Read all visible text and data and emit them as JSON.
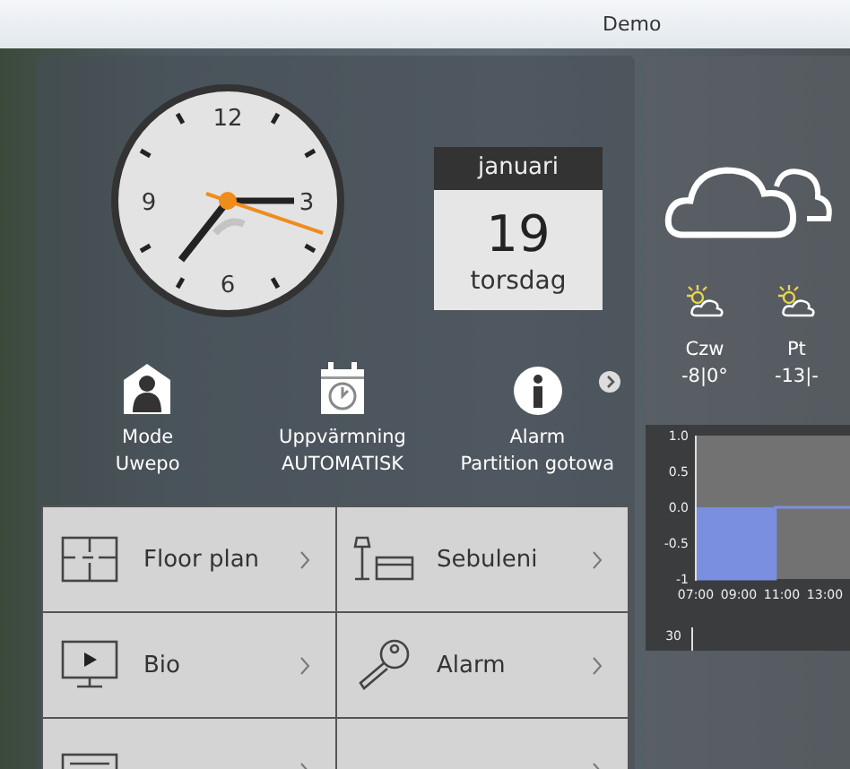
{
  "window": {
    "title": "Demo"
  },
  "clock": {
    "numerals": [
      "12",
      "3",
      "6",
      "9"
    ]
  },
  "calendar": {
    "month": "januari",
    "day": "19",
    "weekday": "torsdag"
  },
  "status_items": [
    {
      "kind": "mode",
      "label": "Mode",
      "value": "Uwepo"
    },
    {
      "kind": "heating",
      "label": "Uppvärmning",
      "value": "AUTOMATISK"
    },
    {
      "kind": "alarm",
      "label": "Alarm",
      "value": "Partition gotowa"
    }
  ],
  "tiles": [
    {
      "kind": "floorplan",
      "label": "Floor plan"
    },
    {
      "kind": "livingroom",
      "label": "Sebuleni"
    },
    {
      "kind": "cinema",
      "label": "Bio"
    },
    {
      "kind": "key",
      "label": "Alarm"
    },
    {
      "kind": "blinds"
    },
    {
      "kind": "line"
    }
  ],
  "weather": {
    "forecast": [
      {
        "day": "Czw",
        "temps": "-8|0°"
      },
      {
        "day": "Pt",
        "temps": "-13|-"
      }
    ],
    "chart_data": {
      "type": "area",
      "x": [
        7,
        10.7,
        10.7,
        15.5
      ],
      "series": [
        {
          "color": "#7b8fe0",
          "values": [
            -1,
            -1,
            0,
            0
          ]
        }
      ],
      "xlim": [
        7,
        15.5
      ],
      "ylim": [
        -1,
        1
      ],
      "xticks": [
        {
          "value": 7,
          "label": "07:00"
        },
        {
          "value": 9,
          "label": "09:00"
        },
        {
          "value": 11,
          "label": "11:00"
        },
        {
          "value": 13,
          "label": "13:00"
        }
      ],
      "yticks": [
        {
          "value": 1,
          "label": "1.0"
        },
        {
          "value": 0.5,
          "label": "0.5"
        },
        {
          "value": 0,
          "label": "0.0"
        },
        {
          "value": -0.5,
          "label": "-0.5"
        },
        {
          "value": -1,
          "label": "-1"
        }
      ]
    },
    "chart_2_tick": "30"
  }
}
